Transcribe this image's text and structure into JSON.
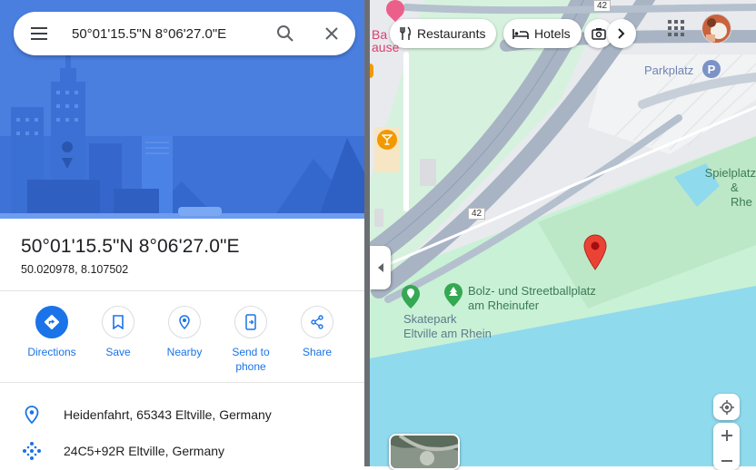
{
  "search": {
    "query": "50°01'15.5\"N 8°06'27.0\"E"
  },
  "place": {
    "title": "50°01'15.5\"N 8°06'27.0\"E",
    "decimal": "50.020978, 8.107502"
  },
  "actions": [
    {
      "label": "Directions"
    },
    {
      "label": "Save"
    },
    {
      "label": "Nearby"
    },
    {
      "label": "Send to phone"
    },
    {
      "label": "Share"
    }
  ],
  "info": {
    "address": "Heidenfahrt, 65343 Eltville, Germany",
    "plus_code": "24C5+92R Eltville, Germany"
  },
  "map": {
    "chips": [
      "Restaurants",
      "Hotels"
    ],
    "labels": {
      "parkplatz": "Parkplatz",
      "spielplatz_line1": "Spielplatz",
      "spielplatz_line2": "& Rhe",
      "bolz_line1": "Bolz- und Streetballplatz",
      "bolz_line2": "am Rheinufer",
      "skatepark_line1": "Skatepark",
      "skatepark_line2": "Eltville am Rhein",
      "road_top": "42",
      "road_mid": "42",
      "partial_label1": "Ba",
      "partial_label2": "ause"
    }
  },
  "colors": {
    "accent": "#1a73e8",
    "pin": "#ea4335",
    "water": "#90daee",
    "park": "#c8f0d4",
    "hero": "#4a7fe0"
  }
}
